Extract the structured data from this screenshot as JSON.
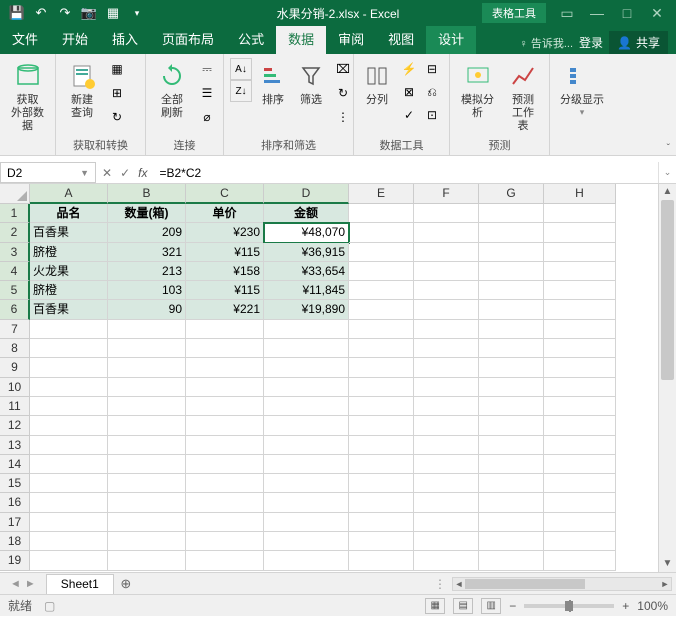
{
  "titlebar": {
    "filename": "水果分销-2.xlsx - Excel",
    "table_tools": "表格工具"
  },
  "tabs": {
    "file": "文件",
    "home": "开始",
    "insert": "插入",
    "layout": "页面布局",
    "formulas": "公式",
    "data": "数据",
    "review": "审阅",
    "view": "视图",
    "design": "设计",
    "tellme": "♀ 告诉我...",
    "signin": "登录",
    "share": "共享"
  },
  "ribbon": {
    "get_data": "获取\n外部数据",
    "get_data_grp": "",
    "new_query": "新建\n查询",
    "show_queries": "⊞",
    "from_table": "▦",
    "recent": "↻",
    "get_transform_grp": "获取和转换",
    "refresh_all": "全部刷新",
    "connections_grp": "连接",
    "sort_az": "A↓Z",
    "sort_za": "Z↓A",
    "sort": "排序",
    "filter": "筛选",
    "sort_filter_grp": "排序和筛选",
    "text_to_col": "分列",
    "data_tools_grp": "数据工具",
    "whatif": "模拟分析",
    "forecast_sheet": "预测\n工作表",
    "forecast_grp": "预测",
    "outline": "分级显示",
    "outline_grp": ""
  },
  "fbar": {
    "namebox": "D2",
    "formula": "=B2*C2"
  },
  "cols": [
    "A",
    "B",
    "C",
    "D",
    "E",
    "F",
    "G",
    "H"
  ],
  "headers": {
    "a": "品名",
    "b": "数量(箱)",
    "c": "单价",
    "d": "金额"
  },
  "rows": [
    {
      "a": "百香果",
      "b": "209",
      "c": "¥230",
      "d": "¥48,070"
    },
    {
      "a": "脐橙",
      "b": "321",
      "c": "¥115",
      "d": "¥36,915"
    },
    {
      "a": "火龙果",
      "b": "213",
      "c": "¥158",
      "d": "¥33,654"
    },
    {
      "a": "脐橙",
      "b": "103",
      "c": "¥115",
      "d": "¥11,845"
    },
    {
      "a": "百香果",
      "b": "90",
      "c": "¥221",
      "d": "¥19,890"
    }
  ],
  "sheet": {
    "name": "Sheet1"
  },
  "status": {
    "ready": "就绪",
    "zoom": "100%"
  }
}
